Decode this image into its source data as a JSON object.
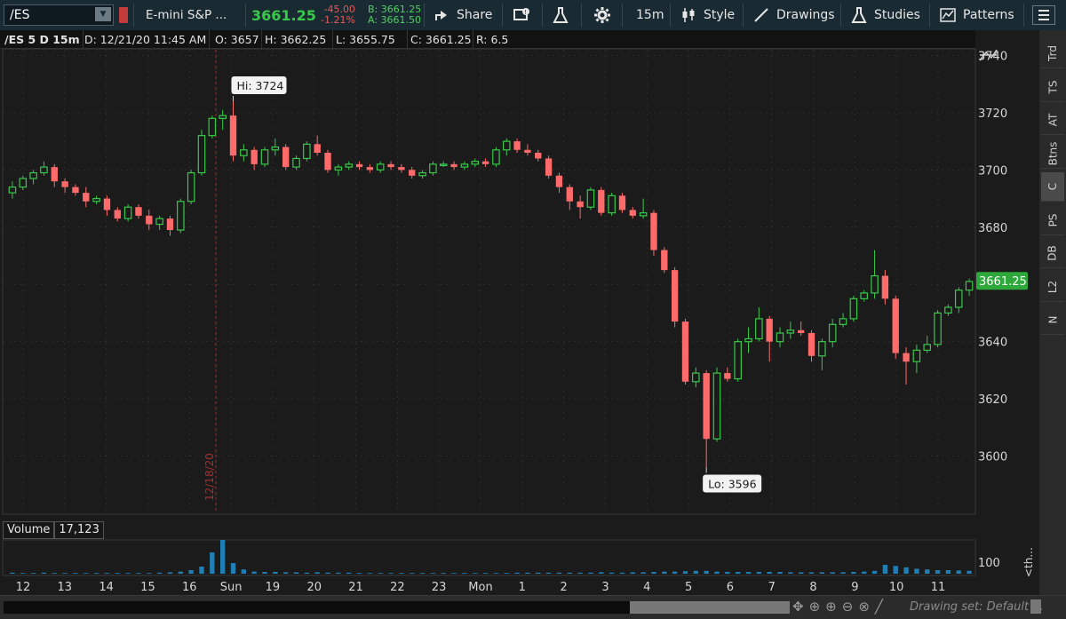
{
  "toolbar": {
    "symbol": "/ES",
    "description": "E-mini S&P ...",
    "last": "3661.25",
    "change": "-45.00",
    "change_pct": "-1.21%",
    "bid": "B: 3661.25",
    "ask": "A: 3661.50",
    "share": "Share",
    "timeframe": "15m",
    "style": "Style",
    "drawings": "Drawings",
    "studies": "Studies",
    "patterns": "Patterns"
  },
  "header": {
    "title": "/ES 5 D 15m",
    "date": "D: 12/21/20 11:45 AM",
    "open": "O: 3657",
    "high": "H: 3662.25",
    "low": "L: 3655.75",
    "close": "C: 3661.25",
    "range": "R: 6.5"
  },
  "volume": {
    "label": "Volume",
    "value": "17,123",
    "axis_label": "100"
  },
  "sidebar": [
    "Trd",
    "TS",
    "AT",
    "Btns",
    "C",
    "PS",
    "DB",
    "L2",
    "N"
  ],
  "bottom": {
    "drawing_set": "Drawing set: Default ..."
  },
  "side_label": "<th...",
  "colors": {
    "up": "#38c94a",
    "down": "#ff6b6b",
    "volume": "#1f7fb5",
    "price_tag": "#2ea83a"
  },
  "chart_data": {
    "type": "candlestick",
    "ylim": [
      3580,
      3742
    ],
    "yticks": [
      3600,
      3620,
      3640,
      3660,
      3680,
      3700,
      3720,
      3740
    ],
    "x_labels": [
      "12",
      "13",
      "14",
      "15",
      "16",
      "Sun",
      "19",
      "20",
      "21",
      "22",
      "23",
      "Mon",
      "1",
      "2",
      "3",
      "4",
      "5",
      "6",
      "7",
      "8",
      "9",
      "10",
      "11"
    ],
    "session_marker": "12/18/20",
    "hi_annotation": "Hi: 3724",
    "lo_annotation": "Lo: 3596",
    "last_price_tag": "3661.25",
    "candles": [
      [
        3692,
        3696,
        3690,
        3694
      ],
      [
        3694,
        3698,
        3693,
        3697
      ],
      [
        3697,
        3700,
        3695,
        3699
      ],
      [
        3699,
        3703,
        3698,
        3701
      ],
      [
        3701,
        3702,
        3694,
        3696
      ],
      [
        3696,
        3697,
        3692,
        3694
      ],
      [
        3694,
        3695,
        3691,
        3692
      ],
      [
        3692,
        3694,
        3687,
        3689
      ],
      [
        3689,
        3691,
        3688,
        3690
      ],
      [
        3690,
        3691,
        3684,
        3686
      ],
      [
        3686,
        3687,
        3682,
        3683
      ],
      [
        3683,
        3688,
        3682,
        3687
      ],
      [
        3687,
        3688,
        3683,
        3684
      ],
      [
        3684,
        3686,
        3679,
        3681
      ],
      [
        3681,
        3684,
        3679,
        3683
      ],
      [
        3683,
        3684,
        3677,
        3679
      ],
      [
        3679,
        3690,
        3678,
        3689
      ],
      [
        3689,
        3700,
        3688,
        3699
      ],
      [
        3699,
        3714,
        3698,
        3712
      ],
      [
        3712,
        3719,
        3711,
        3718
      ],
      [
        3718,
        3721,
        3714,
        3719
      ],
      [
        3719,
        3724,
        3703,
        3705
      ],
      [
        3705,
        3709,
        3703,
        3707
      ],
      [
        3707,
        3708,
        3700,
        3702
      ],
      [
        3702,
        3708,
        3701,
        3707
      ],
      [
        3707,
        3711,
        3705,
        3708
      ],
      [
        3708,
        3709,
        3700,
        3701
      ],
      [
        3701,
        3705,
        3700,
        3704
      ],
      [
        3704,
        3710,
        3703,
        3709
      ],
      [
        3709,
        3712,
        3705,
        3706
      ],
      [
        3706,
        3707,
        3699,
        3700
      ],
      [
        3700,
        3702,
        3698,
        3701
      ],
      [
        3701,
        3703,
        3700,
        3702
      ],
      [
        3702,
        3703,
        3700,
        3701
      ],
      [
        3701,
        3702,
        3699,
        3700
      ],
      [
        3700,
        3703,
        3699,
        3702
      ],
      [
        3702,
        3703,
        3700,
        3701
      ],
      [
        3701,
        3702,
        3699,
        3700
      ],
      [
        3700,
        3701,
        3697,
        3698
      ],
      [
        3698,
        3700,
        3697,
        3699
      ],
      [
        3699,
        3703,
        3698,
        3702
      ],
      [
        3702,
        3703,
        3701,
        3702
      ],
      [
        3702,
        3703,
        3700,
        3701
      ],
      [
        3701,
        3703,
        3700,
        3702
      ],
      [
        3702,
        3704,
        3701,
        3703
      ],
      [
        3703,
        3704,
        3701,
        3702
      ],
      [
        3702,
        3708,
        3701,
        3707
      ],
      [
        3707,
        3711,
        3705,
        3710
      ],
      [
        3710,
        3711,
        3706,
        3707
      ],
      [
        3707,
        3709,
        3705,
        3706
      ],
      [
        3706,
        3707,
        3703,
        3704
      ],
      [
        3704,
        3705,
        3697,
        3698
      ],
      [
        3698,
        3699,
        3692,
        3694
      ],
      [
        3694,
        3695,
        3686,
        3689
      ],
      [
        3689,
        3691,
        3683,
        3687
      ],
      [
        3687,
        3694,
        3686,
        3693
      ],
      [
        3693,
        3694,
        3684,
        3685
      ],
      [
        3685,
        3692,
        3684,
        3691
      ],
      [
        3691,
        3692,
        3685,
        3686
      ],
      [
        3686,
        3687,
        3683,
        3684
      ],
      [
        3684,
        3690,
        3683,
        3685
      ],
      [
        3685,
        3686,
        3670,
        3672
      ],
      [
        3672,
        3673,
        3664,
        3665
      ],
      [
        3665,
        3666,
        3645,
        3647
      ],
      [
        3647,
        3648,
        3625,
        3626
      ],
      [
        3626,
        3631,
        3624,
        3629
      ],
      [
        3629,
        3630,
        3596,
        3606
      ],
      [
        3606,
        3631,
        3605,
        3629
      ],
      [
        3629,
        3631,
        3626,
        3627
      ],
      [
        3627,
        3641,
        3626,
        3640
      ],
      [
        3640,
        3645,
        3636,
        3641
      ],
      [
        3641,
        3652,
        3640,
        3648
      ],
      [
        3648,
        3649,
        3633,
        3640
      ],
      [
        3640,
        3645,
        3638,
        3643
      ],
      [
        3643,
        3647,
        3641,
        3644
      ],
      [
        3644,
        3647,
        3642,
        3643
      ],
      [
        3643,
        3644,
        3633,
        3635
      ],
      [
        3635,
        3641,
        3630,
        3640
      ],
      [
        3640,
        3648,
        3638,
        3646
      ],
      [
        3646,
        3650,
        3645,
        3648
      ],
      [
        3648,
        3656,
        3647,
        3655
      ],
      [
        3655,
        3658,
        3654,
        3657
      ],
      [
        3657,
        3672,
        3655,
        3663
      ],
      [
        3663,
        3665,
        3653,
        3655
      ],
      [
        3655,
        3656,
        3634,
        3636
      ],
      [
        3636,
        3638,
        3625,
        3633
      ],
      [
        3633,
        3639,
        3629,
        3637
      ],
      [
        3637,
        3642,
        3636,
        3639
      ],
      [
        3639,
        3651,
        3638,
        3650
      ],
      [
        3650,
        3653,
        3649,
        3652
      ],
      [
        3652,
        3659,
        3650,
        3658
      ],
      [
        3658,
        3662,
        3656,
        3661
      ]
    ],
    "volumes": [
      3,
      2,
      2,
      3,
      2,
      2,
      2,
      2,
      2,
      2,
      2,
      2,
      2,
      2,
      3,
      4,
      6,
      10,
      20,
      60,
      95,
      30,
      12,
      6,
      5,
      5,
      4,
      4,
      3,
      4,
      3,
      3,
      3,
      2,
      2,
      2,
      2,
      2,
      2,
      2,
      2,
      2,
      2,
      2,
      2,
      2,
      2,
      2,
      3,
      3,
      3,
      3,
      3,
      3,
      3,
      3,
      4,
      3,
      3,
      4,
      4,
      5,
      6,
      6,
      7,
      8,
      8,
      6,
      5,
      5,
      5,
      5,
      5,
      5,
      4,
      4,
      4,
      4,
      4,
      4,
      5,
      6,
      8,
      25,
      22,
      18,
      14,
      12,
      10,
      10,
      9,
      8,
      7,
      6
    ]
  }
}
